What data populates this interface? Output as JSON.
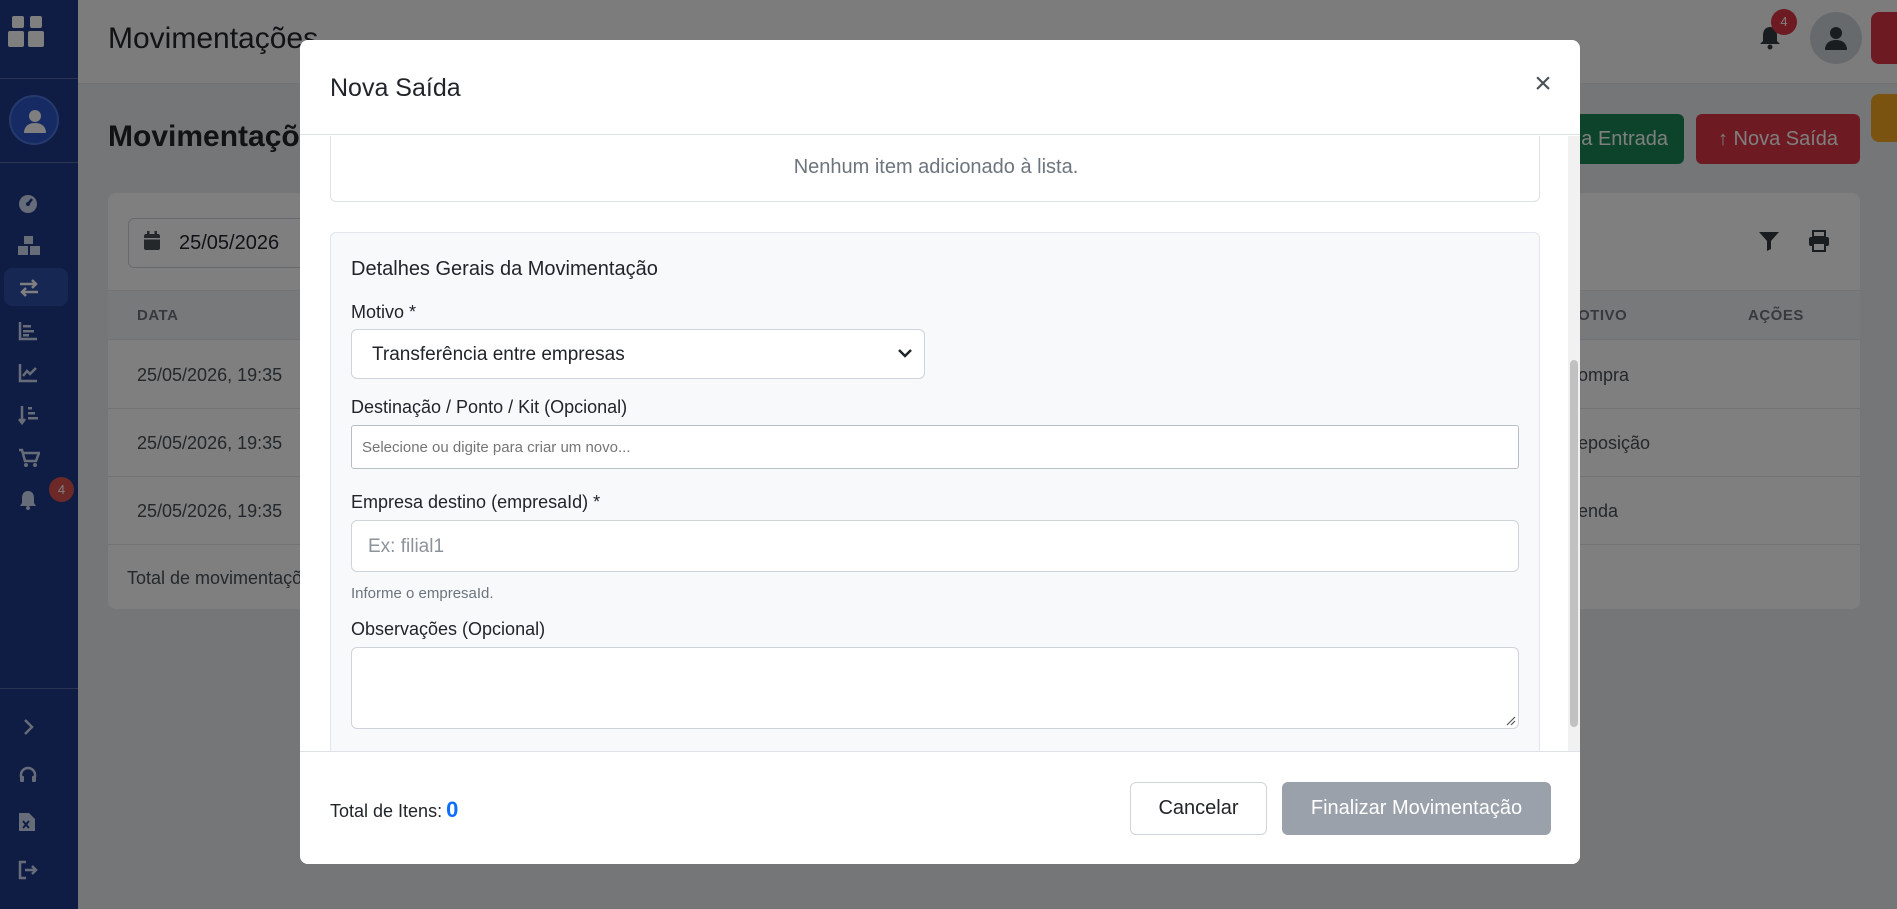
{
  "app": {
    "header_title": "Movimentações",
    "notifications_count": "4"
  },
  "sidebar": {
    "notifications_badge": "4",
    "items": [
      {
        "icon": "dashboard-icon"
      },
      {
        "icon": "boxes-icon"
      },
      {
        "icon": "exchange-icon"
      },
      {
        "icon": "list-chart-icon"
      },
      {
        "icon": "line-chart-icon"
      },
      {
        "icon": "sort-amount-icon"
      },
      {
        "icon": "cart-icon"
      },
      {
        "icon": "bell-icon"
      }
    ],
    "bottom_items": [
      {
        "icon": "chevron-right-icon"
      },
      {
        "icon": "headset-icon"
      },
      {
        "icon": "excel-file-icon"
      },
      {
        "icon": "logout-icon"
      }
    ]
  },
  "page": {
    "title": "Movimentaçõe",
    "btn_entrada": "a Entrada",
    "btn_saida": "Nova Saída",
    "date_filter": "25/05/2026",
    "table_headers": {
      "data": "DATA",
      "motivo": "OTIVO",
      "acoes": "AÇÕES"
    },
    "rows": [
      {
        "data": "25/05/2026, 19:35",
        "motivo": "ompra"
      },
      {
        "data": "25/05/2026, 19:35",
        "motivo": "eposição"
      },
      {
        "data": "25/05/2026, 19:35",
        "motivo": "enda"
      }
    ],
    "total_label": "Total de movimentaçõ"
  },
  "modal": {
    "title": "Nova Saída",
    "empty_list": "Nenhum item adicionado à lista.",
    "details_title": "Detalhes Gerais da Movimentação",
    "motivo_label": "Motivo *",
    "motivo_value": "Transferência entre empresas",
    "destinacao_label": "Destinação / Ponto / Kit (Opcional)",
    "destinacao_placeholder": "Selecione ou digite para criar um novo...",
    "empresa_label": "Empresa destino (empresaId) *",
    "empresa_placeholder": "Ex: filial1",
    "empresa_help": "Informe o empresaId.",
    "observacoes_label": "Observações (Opcional)",
    "total_items_label": "Total de Itens:",
    "total_items_value": "0",
    "cancel_label": "Cancelar",
    "finalize_label": "Finalizar Movimentação"
  },
  "colors": {
    "sidebar": "#1f3a8a",
    "success": "#198754",
    "danger": "#dc3545",
    "primary": "#0d6efd",
    "disabled_button": "#9aa1ab"
  }
}
